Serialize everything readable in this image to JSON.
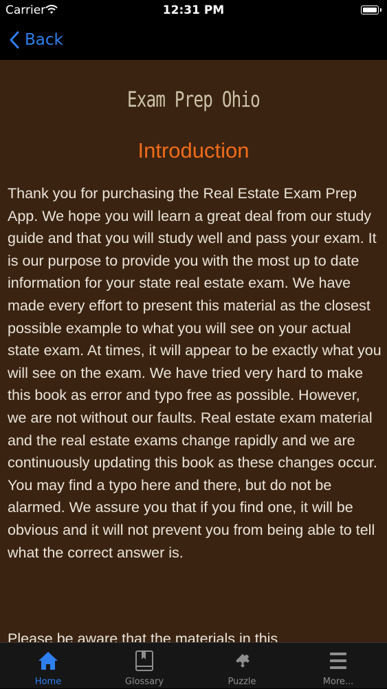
{
  "status_bar": {
    "carrier": "Carrier",
    "time": "12:31 PM"
  },
  "nav": {
    "back_label": "Back"
  },
  "content": {
    "app_title": "Exam Prep Ohio",
    "heading": "Introduction",
    "paragraphs": [
      "Thank you for purchasing the Real Estate Exam Prep App. We hope you will learn a great deal from our study guide and that you will study well and pass your exam. It is our purpose to provide you with the most up to date information for your state real estate exam. We have made every effort to present this material as the closest possible example to what you will see on your actual state exam. At times, it will appear to be exactly what you will see on the exam. We have tried very hard to make this book as error and typo free as possible. However, we are not without our faults. Real estate exam material and the real estate exams change rapidly and we are continuously updating this book as these changes occur. You may find a typo here and there, but do not be alarmed. We assure you that if you find one, it will be obvious and it will not prevent you from being able to tell what the correct answer is.",
      "Please be aware that the materials in this"
    ]
  },
  "tabs": [
    {
      "label": "Home",
      "icon": "home-icon",
      "active": true
    },
    {
      "label": "Glossary",
      "icon": "book-icon",
      "active": false
    },
    {
      "label": "Puzzle",
      "icon": "puzzle-icon",
      "active": false
    },
    {
      "label": "More...",
      "icon": "more-icon",
      "active": false
    }
  ],
  "colors": {
    "accent": "#2f7ff0",
    "content_background": "#3b2311",
    "heading": "#ef6c1a",
    "body_text": "#e9e4da"
  }
}
